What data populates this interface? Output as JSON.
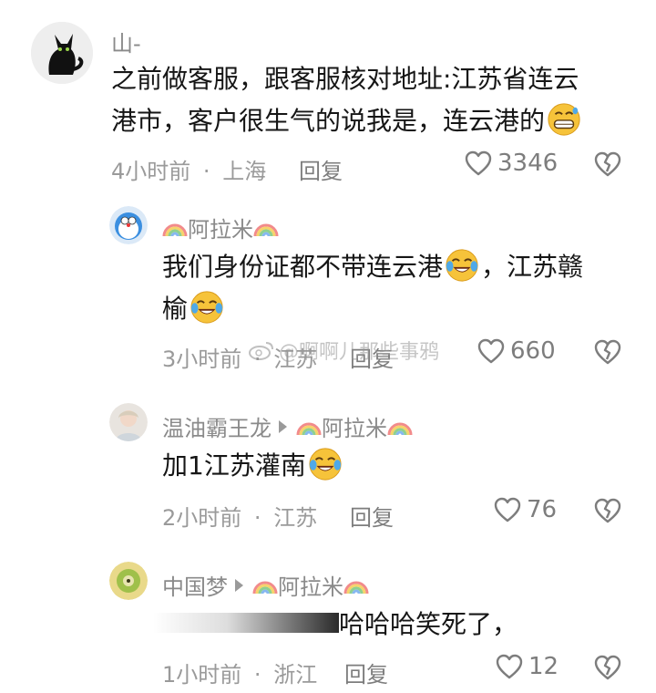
{
  "comments": [
    {
      "user": "山-",
      "text_line1": "之前做客服，跟客服核对地址:江苏省连云",
      "text_line2": "港市，客户很生气的说我是，连云港的",
      "time": "4小时前",
      "sep": "·",
      "location": "上海",
      "reply": "回复",
      "likes": "3346"
    },
    {
      "user": "阿拉米",
      "text_line1": "我们身份证都不带连云港",
      "text_line1b": "，江苏赣",
      "text_line2": "榆",
      "time": "3小时前",
      "sep": "·",
      "location": "江苏",
      "reply": "回复",
      "likes": "660"
    },
    {
      "user": "温油霸王龙",
      "reply_to": "阿拉米",
      "text_line1": "加1江苏灌南",
      "time": "2小时前",
      "sep": "·",
      "location": "江苏",
      "reply": "回复",
      "likes": "76"
    },
    {
      "user": "中国梦",
      "reply_to": "阿拉米",
      "text_line1": "哈哈哈笑死了，",
      "time": "1小时前",
      "sep": "·",
      "location": "浙江",
      "reply": "回复",
      "likes": "12"
    }
  ],
  "watermark": "@啊啊儿那些事鸦",
  "colors": {
    "text": "#161616",
    "meta": "#9a9a9a",
    "emoji": "#f6c33a"
  },
  "icons": [
    "heart-icon",
    "broken-heart-icon",
    "crying-laugh-emoji",
    "rainbow-icon",
    "weibo-icon"
  ]
}
